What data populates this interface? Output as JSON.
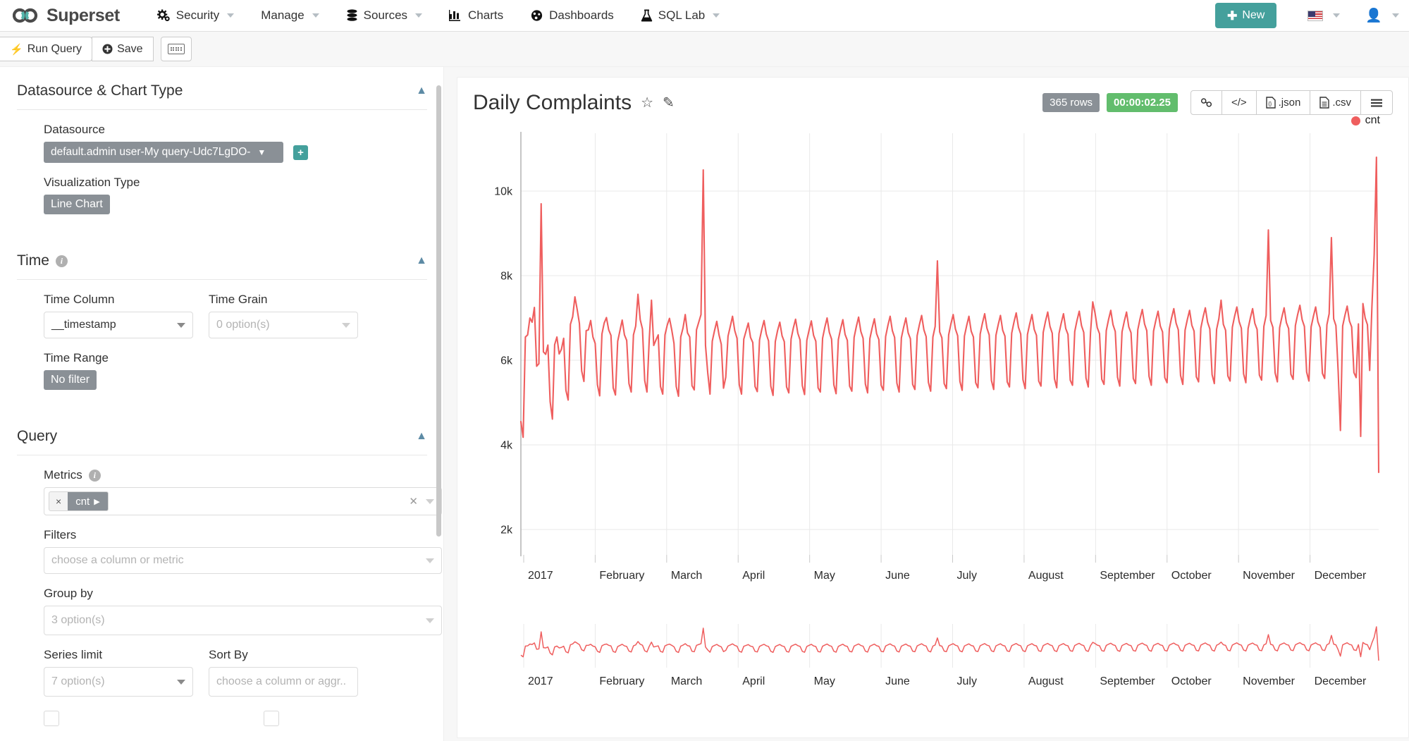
{
  "navbar": {
    "brand": "Superset",
    "items": [
      {
        "label": "Security",
        "icon": "gears-icon",
        "caret": true
      },
      {
        "label": "Manage",
        "icon": null,
        "caret": true
      },
      {
        "label": "Sources",
        "icon": "database-icon",
        "caret": true
      },
      {
        "label": "Charts",
        "icon": "bar-chart-icon",
        "caret": false
      },
      {
        "label": "Dashboards",
        "icon": "dashboard-icon",
        "caret": false
      },
      {
        "label": "SQL Lab",
        "icon": "flask-icon",
        "caret": true
      }
    ],
    "new_button": "New",
    "new_button_color": "#44a09c",
    "locale_icon": "us-flag-icon",
    "user_icon": "user-icon"
  },
  "toolbar": {
    "run_query": "Run Query",
    "save": "Save",
    "keyboard_shortcuts_icon": "keyboard-icon"
  },
  "control_panel": {
    "sections": [
      {
        "title": "Datasource & Chart Type",
        "fields": {
          "datasource_label": "Datasource",
          "datasource_value": "default.admin user-My query-Udc7LgDO-",
          "add_datasource": "+",
          "viz_type_label": "Visualization Type",
          "viz_type_value": "Line Chart"
        }
      },
      {
        "title": "Time",
        "has_info": true,
        "fields": {
          "time_column_label": "Time Column",
          "time_column_value": "__timestamp",
          "time_grain_label": "Time Grain",
          "time_grain_placeholder": "0 option(s)",
          "time_range_label": "Time Range",
          "time_range_value": "No filter"
        }
      },
      {
        "title": "Query",
        "fields": {
          "metrics_label": "Metrics",
          "metric_tag": "cnt",
          "metric_remove": "×",
          "filters_label": "Filters",
          "filters_placeholder": "choose a column or metric",
          "group_by_label": "Group by",
          "group_by_placeholder": "3 option(s)",
          "series_limit_label": "Series limit",
          "series_limit_placeholder": "7 option(s)",
          "sort_by_label": "Sort By",
          "sort_by_placeholder": "choose a column or aggr.."
        }
      }
    ]
  },
  "chart_header": {
    "title": "Daily Complaints",
    "favorite_icon": "star-icon",
    "edit_icon": "edit-icon",
    "rows_badge": "365 rows",
    "time_badge": "00:00:02.25",
    "time_badge_color": "#62bd6d",
    "actions": [
      {
        "name": "share-link-button",
        "icon": "link-icon",
        "label": ""
      },
      {
        "name": "view-query-button",
        "icon": "code-icon",
        "label": ""
      },
      {
        "name": "export-json-button",
        "icon": "json-file-icon",
        "label": ".json"
      },
      {
        "name": "export-csv-button",
        "icon": "csv-file-icon",
        "label": ".csv"
      },
      {
        "name": "more-menu-button",
        "icon": "hamburger-icon",
        "label": ""
      }
    ]
  },
  "chart_data": {
    "type": "line",
    "title": "Daily Complaints",
    "xlabel": "",
    "ylabel": "",
    "grid": true,
    "legend_position": "top-right",
    "series_color": "#ef5e5e",
    "ylim": [
      1400,
      11200
    ],
    "ytick_labels": [
      "2k",
      "4k",
      "6k",
      "8k",
      "10k"
    ],
    "ytick_values": [
      2000,
      4000,
      6000,
      8000,
      10000
    ],
    "xtick_labels": [
      "2017",
      "February",
      "March",
      "April",
      "May",
      "June",
      "July",
      "August",
      "September",
      "October",
      "November",
      "December"
    ],
    "series": [
      {
        "name": "cnt",
        "values": [
          4550,
          4180,
          6550,
          6600,
          7000,
          6900,
          7250,
          5860,
          5920,
          9700,
          6200,
          6140,
          6360,
          5020,
          4610,
          6370,
          6550,
          6150,
          6260,
          6520,
          5290,
          5060,
          6850,
          7030,
          7500,
          7200,
          6870,
          5750,
          5500,
          6700,
          6720,
          6940,
          6550,
          6400,
          5420,
          5160,
          6620,
          6880,
          7010,
          6720,
          6590,
          5350,
          5180,
          6450,
          6700,
          6950,
          6600,
          6470,
          5450,
          5250,
          6600,
          6810,
          7560,
          6960,
          6740,
          5520,
          5250,
          6480,
          7420,
          6350,
          6480,
          6600,
          5380,
          5200,
          6600,
          6830,
          6990,
          6720,
          6400,
          5380,
          5150,
          6550,
          6760,
          7080,
          6650,
          6550,
          5400,
          5300,
          6720,
          6900,
          7080,
          10500,
          6350,
          5700,
          5200,
          6450,
          6700,
          6920,
          6600,
          6380,
          5340,
          5600,
          6570,
          6800,
          7040,
          6700,
          6520,
          5420,
          5200,
          6500,
          6690,
          6880,
          6540,
          6420,
          5380,
          5260,
          6480,
          6730,
          6940,
          6620,
          6460,
          5390,
          5170,
          6440,
          6700,
          6900,
          6580,
          6440,
          5370,
          5230,
          6500,
          6760,
          6970,
          6640,
          6480,
          5400,
          5190,
          6470,
          6710,
          6930,
          6590,
          6450,
          5350,
          5250,
          6520,
          6780,
          7000,
          6660,
          6500,
          5420,
          5210,
          6490,
          6740,
          6960,
          6610,
          6470,
          5390,
          5270,
          6540,
          6800,
          7020,
          6680,
          6520,
          5440,
          5230,
          6510,
          6760,
          6980,
          6630,
          6490,
          5410,
          5290,
          6560,
          6820,
          7040,
          6700,
          6540,
          5460,
          5250,
          6530,
          6780,
          7000,
          6650,
          6510,
          5430,
          5310,
          6580,
          6840,
          7060,
          6720,
          6560,
          5480,
          5270,
          6550,
          6800,
          8350,
          6670,
          6530,
          5450,
          5330,
          6600,
          6860,
          7080,
          6740,
          6580,
          5500,
          5290,
          6570,
          6820,
          7040,
          6690,
          6550,
          5470,
          5350,
          6620,
          6880,
          7100,
          6760,
          6600,
          5520,
          5310,
          6590,
          6840,
          7060,
          6710,
          6570,
          5490,
          5370,
          6640,
          6900,
          7120,
          6780,
          6620,
          5540,
          5330,
          6610,
          6860,
          7080,
          6730,
          6590,
          5510,
          5390,
          6660,
          6920,
          7140,
          6800,
          6640,
          5560,
          5350,
          6630,
          6880,
          7100,
          6750,
          6610,
          5530,
          5410,
          6680,
          6940,
          7160,
          6820,
          6660,
          5580,
          5370,
          6650,
          7380,
          7120,
          6770,
          6630,
          5550,
          5430,
          6700,
          6960,
          7180,
          6840,
          6680,
          5600,
          5390,
          6670,
          6920,
          7140,
          6790,
          6650,
          5570,
          5450,
          6720,
          6980,
          7200,
          6860,
          6700,
          5620,
          5410,
          6690,
          6940,
          7160,
          6810,
          6670,
          5590,
          5470,
          6740,
          7000,
          7220,
          6880,
          6720,
          5640,
          5430,
          6710,
          6960,
          7180,
          6830,
          6690,
          5610,
          5490,
          6760,
          7020,
          7240,
          6900,
          6740,
          5660,
          5450,
          6730,
          6980,
          7420,
          6850,
          6710,
          5630,
          5510,
          6780,
          7040,
          7260,
          6920,
          6760,
          5680,
          5470,
          6750,
          7000,
          7220,
          6870,
          6730,
          5650,
          5530,
          6800,
          7060,
          9080,
          6940,
          6780,
          5700,
          5490,
          6770,
          7020,
          7240,
          6890,
          6750,
          5670,
          5550,
          6820,
          7080,
          7300,
          6960,
          6800,
          5720,
          5510,
          6790,
          7040,
          7260,
          6910,
          6770,
          5690,
          5570,
          6840,
          7100,
          8900,
          6980,
          6820,
          5740,
          4340,
          6810,
          7060,
          7280,
          6930,
          6790,
          5710,
          5590,
          6860,
          4200,
          7340,
          7000,
          6840,
          5760,
          7280,
          8500,
          10800,
          3350
        ]
      }
    ],
    "minimap": {
      "present": true,
      "xtick_labels": [
        "2017",
        "February",
        "March",
        "April",
        "May",
        "June",
        "July",
        "August",
        "September",
        "October",
        "November",
        "December"
      ]
    }
  }
}
